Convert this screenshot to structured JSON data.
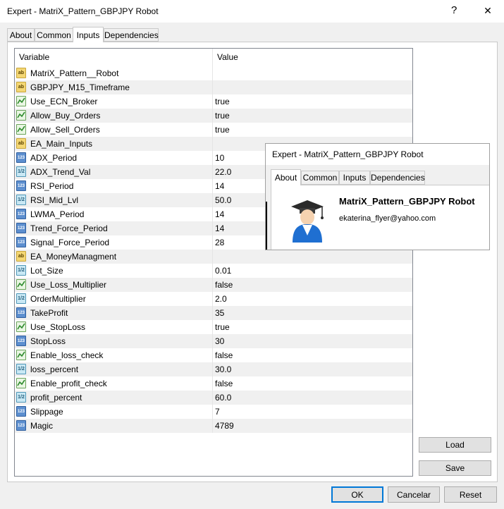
{
  "window": {
    "title": "Expert - MatriX_Pattern_GBPJPY Robot",
    "help_glyph": "?",
    "close_glyph": "✕"
  },
  "tabs": [
    {
      "label": "About",
      "active": false
    },
    {
      "label": "Common",
      "active": false
    },
    {
      "label": "Inputs",
      "active": true
    },
    {
      "label": "Dependencies",
      "active": false
    }
  ],
  "grid": {
    "columns": {
      "variable": "Variable",
      "value": "Value"
    },
    "rows": [
      {
        "type": "string",
        "icon": "string-type-icon",
        "variable": "MatriX_Pattern__Robot",
        "value": ""
      },
      {
        "type": "string",
        "icon": "string-type-icon",
        "variable": "GBPJPY_M15_Timeframe",
        "value": ""
      },
      {
        "type": "bool",
        "icon": "bool-type-icon",
        "variable": "Use_ECN_Broker",
        "value": "true"
      },
      {
        "type": "bool",
        "icon": "bool-type-icon",
        "variable": "Allow_Buy_Orders",
        "value": "true"
      },
      {
        "type": "bool",
        "icon": "bool-type-icon",
        "variable": "Allow_Sell_Orders",
        "value": "true"
      },
      {
        "type": "string",
        "icon": "string-type-icon",
        "variable": "EA_Main_Inputs",
        "value": ""
      },
      {
        "type": "int",
        "icon": "integer-type-icon",
        "variable": "ADX_Period",
        "value": "10"
      },
      {
        "type": "double",
        "icon": "double-type-icon",
        "variable": "ADX_Trend_Val",
        "value": "22.0"
      },
      {
        "type": "int",
        "icon": "integer-type-icon",
        "variable": "RSI_Period",
        "value": "14"
      },
      {
        "type": "double",
        "icon": "double-type-icon",
        "variable": "RSI_Mid_Lvl",
        "value": "50.0"
      },
      {
        "type": "int",
        "icon": "integer-type-icon",
        "variable": "LWMA_Period",
        "value": "14"
      },
      {
        "type": "int",
        "icon": "integer-type-icon",
        "variable": "Trend_Force_Period",
        "value": "14"
      },
      {
        "type": "int",
        "icon": "integer-type-icon",
        "variable": "Signal_Force_Period",
        "value": "28"
      },
      {
        "type": "string",
        "icon": "string-type-icon",
        "variable": "EA_MoneyManagment",
        "value": ""
      },
      {
        "type": "double",
        "icon": "double-type-icon",
        "variable": "Lot_Size",
        "value": "0.01"
      },
      {
        "type": "bool",
        "icon": "bool-type-icon",
        "variable": "Use_Loss_Multiplier",
        "value": "false"
      },
      {
        "type": "double",
        "icon": "double-type-icon",
        "variable": "OrderMultiplier",
        "value": "2.0"
      },
      {
        "type": "int",
        "icon": "integer-type-icon",
        "variable": "TakeProfit",
        "value": "35"
      },
      {
        "type": "bool",
        "icon": "bool-type-icon",
        "variable": "Use_StopLoss",
        "value": "true"
      },
      {
        "type": "int",
        "icon": "integer-type-icon",
        "variable": "StopLoss",
        "value": "30"
      },
      {
        "type": "bool",
        "icon": "bool-type-icon",
        "variable": "Enable_loss_check",
        "value": "false"
      },
      {
        "type": "double",
        "icon": "double-type-icon",
        "variable": "loss_percent",
        "value": "30.0"
      },
      {
        "type": "bool",
        "icon": "bool-type-icon",
        "variable": "Enable_profit_check",
        "value": "false"
      },
      {
        "type": "double",
        "icon": "double-type-icon",
        "variable": "profit_percent",
        "value": "60.0"
      },
      {
        "type": "int",
        "icon": "integer-type-icon",
        "variable": "Slippage",
        "value": "7"
      },
      {
        "type": "int",
        "icon": "integer-type-icon",
        "variable": "Magic",
        "value": "4789"
      }
    ]
  },
  "icon_labels": {
    "string": "ab",
    "int": "123",
    "double": "1/2"
  },
  "side_buttons": {
    "load": "Load",
    "save": "Save"
  },
  "footer_buttons": {
    "ok": "OK",
    "cancel": "Cancelar",
    "reset": "Reset"
  },
  "overlay": {
    "title": "Expert - MatriX_Pattern_GBPJPY Robot",
    "tabs": [
      {
        "label": "About",
        "active": true
      },
      {
        "label": "Common",
        "active": false
      },
      {
        "label": "Inputs",
        "active": false
      },
      {
        "label": "Dependencies",
        "active": false
      }
    ],
    "name": "MatriX_Pattern_GBPJPY Robot",
    "email": "ekaterina_flyer@yahoo.com"
  },
  "colors": {
    "accent": "#0078d7",
    "row_alt": "#f0f0f0",
    "border": "#828790"
  }
}
